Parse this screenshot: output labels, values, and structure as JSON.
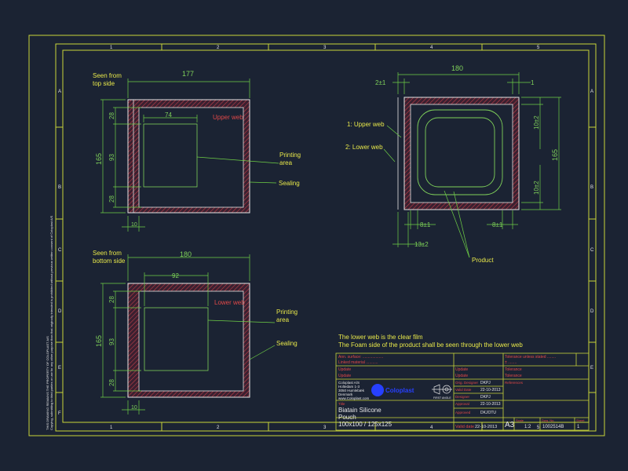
{
  "colors": {
    "background": "#1b2333",
    "frame": "#c8d43a",
    "dimension": "#6fd046",
    "text": "#e8e84a",
    "outline_white": "#e6e6e6",
    "seal_red": "#d24040",
    "logo_blue": "#2740ff"
  },
  "grid": {
    "columns": [
      "1",
      "2",
      "3",
      "4",
      "5"
    ],
    "rows": [
      "A",
      "B",
      "C",
      "D",
      "E",
      "F"
    ]
  },
  "side_note": [
    "THIS DRAWING REMAINS THE PROPERTY OF COLOPLAST A/S",
    "Copying, submitting to third parties or use for any other purpose than that originally intended is prohibited without previous written consent of Coloplast A/S"
  ],
  "view_top": {
    "label_line1": "Seen from",
    "label_line2": "top side",
    "dim_width": "177",
    "dim_print_width": "74",
    "dim_height": "165",
    "dim_28_top": "28",
    "dim_93": "93",
    "dim_28_bottom": "28",
    "dim_10": "10",
    "web_label": "Upper web",
    "printing_line1": "Printing",
    "printing_line2": "area",
    "sealing": "Sealing"
  },
  "view_bottom": {
    "label_line1": "Seen from",
    "label_line2": "bottom side",
    "dim_width": "180",
    "dim_print_width": "92",
    "dim_height": "165",
    "dim_28_top": "28",
    "dim_93": "93",
    "dim_28_bottom": "28",
    "dim_10": "10",
    "web_label": "Lower web",
    "printing_line1": "Printing",
    "printing_line2": "area",
    "sealing": "Sealing"
  },
  "view_section": {
    "dim_width": "180",
    "dim_left": "2±1",
    "dim_right": "1",
    "dim_height": "165",
    "dim_10_top": "10±2",
    "dim_10_bottom": "10±2",
    "dim_8_left": "8±1",
    "dim_8_right": "8±1",
    "dim_13": "13±2",
    "upper_web": "1: Upper web",
    "lower_web": "2: Lower web",
    "product": "Product"
  },
  "notes": {
    "line1": "The lower web is the clear film",
    "line2": "The Foam side of the product shall be seen through the lower web"
  },
  "title_block": {
    "red_row1": "Ann. surface: ...................",
    "red_row2": "Linked material ...........",
    "red_row3": "Update",
    "red_row4": "Update",
    "red_mid1": "Update",
    "red_mid2": "Update",
    "red_right1": "Tolerance unless stated ........",
    "red_right2": "± ........",
    "red_right3": "Tolerance",
    "red_right4": "Tolerance",
    "company_name": "Coloplast A/S",
    "company_addr1": "Holtedam 1-3",
    "company_addr2": "3050 Humlebæk",
    "company_country": "Denmark",
    "company_web": "www.Coloplast.com",
    "logo_text": "Coloplast",
    "projection_label": "FIRST ANGLE",
    "orig_designer_label": "Orig. Designer",
    "orig_designer": "DKPJ",
    "valid_date_label": "Valid Date",
    "valid_date_value": "22-10-2013",
    "designer_label": "Designer",
    "designer": "DKPJ",
    "approval_label": "Approval",
    "approval_date": "22-10-2013",
    "approved_label": "Approved",
    "approved_by": "DKJOTU",
    "title_label": "Title",
    "title_line1": "Biatain Silicone",
    "title_line2": "Pouch",
    "title_line3": "100x100 / 125x125",
    "valid_label": "Valid date",
    "valid_value": "22-10-2013",
    "format": "A3",
    "scale_label": "Scale",
    "scale": "1:2",
    "dwg_label": "Dwg. No.",
    "dwg_no": "1002514B",
    "sheet_label": "Sheet",
    "sheet": "1",
    "references_label": "References"
  }
}
